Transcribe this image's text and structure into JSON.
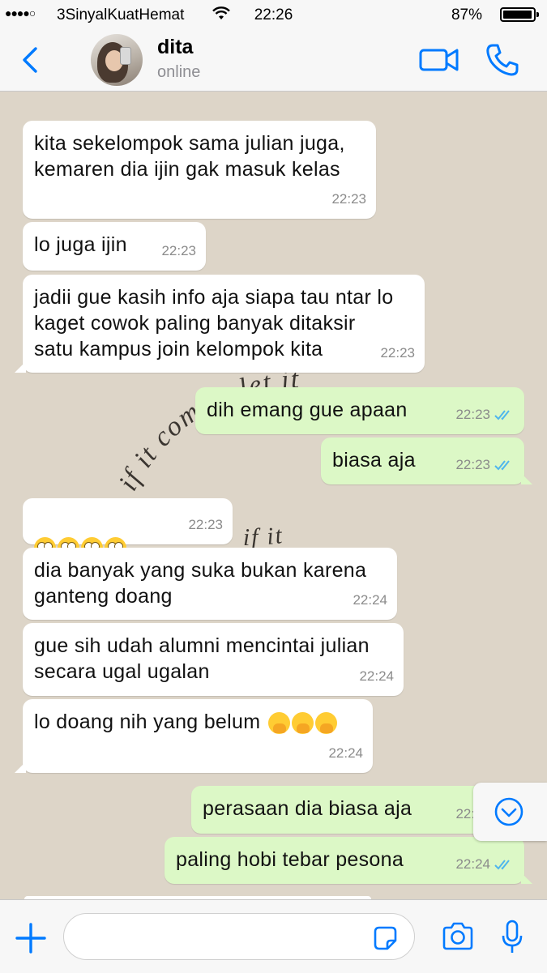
{
  "status_bar": {
    "signal": "●●●●○",
    "carrier": "3SinyalKuatHemat",
    "time": "22:26",
    "battery": "87%",
    "battery_level": 0.87
  },
  "header": {
    "contact_name": "dita",
    "contact_status": "online"
  },
  "watermark": {
    "line1": "if it comes, let it",
    "line2": "if     it"
  },
  "messages": [
    {
      "dir": "in",
      "text": "kita sekelompok sama julian juga,\nkemaren dia ijin gak masuk kelas",
      "time": "22:23"
    },
    {
      "dir": "in",
      "text": "lo juga ijin",
      "time": "22:23"
    },
    {
      "dir": "in",
      "text": "jadii gue kasih info aja siapa tau ntar lo\nkaget cowok paling banyak ditaksir\nsatu kampus join kelompok kita",
      "time": "22:23"
    },
    {
      "dir": "out",
      "text": "dih emang gue apaan",
      "time": "22:23",
      "read": true
    },
    {
      "dir": "out",
      "text": "biasa aja",
      "time": "22:23",
      "read": true
    },
    {
      "dir": "in",
      "text": "🙄🙄🙄🙄",
      "time": "22:23",
      "emoji_icon": "face-with-rolling-eyes-icon"
    },
    {
      "dir": "in",
      "text": "dia banyak yang suka bukan karena\nganteng doang",
      "time": "22:24"
    },
    {
      "dir": "in",
      "text": "gue sih udah alumni mencintai julian\nsecara ugal ugalan",
      "time": "22:24"
    },
    {
      "dir": "in",
      "text": "lo doang nih yang belum 🤭🤭🤭",
      "time": "22:24",
      "emoji_icon": "face-with-hand-over-mouth-icon"
    },
    {
      "dir": "out",
      "text": "perasaan dia biasa aja",
      "time": "22:24",
      "read": true
    },
    {
      "dir": "out",
      "text": "paling hobi tebar pesona",
      "time": "22:24",
      "read": true
    }
  ],
  "colors": {
    "accent": "#007aff",
    "incoming_bubble": "#ffffff",
    "outgoing_bubble": "#dcf8c6",
    "read_ticks": "#4fb6ec",
    "chat_background": "#ddd5c8"
  },
  "input": {
    "placeholder": ""
  }
}
